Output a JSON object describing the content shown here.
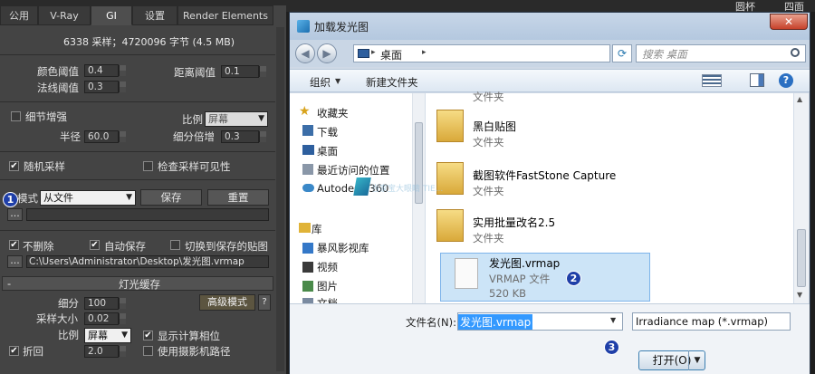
{
  "panel": {
    "tabs": [
      "公用",
      "V-Ray",
      "GI",
      "设置",
      "Render Elements"
    ],
    "active_tab": "GI",
    "stats": "6338 采样；4720096 字节 (4.5 MB)",
    "color_threshold_label": "颜色阈值",
    "color_threshold_value": "0.4",
    "normal_threshold_label": "法线阈值",
    "normal_threshold_value": "0.3",
    "distance_threshold_label": "距离阈值",
    "distance_threshold_value": "0.1",
    "detail_enhance_label": "细节增强",
    "scale_label": "比例",
    "scale_value": "屏幕",
    "radius_label": "半径",
    "radius_value": "60.0",
    "subdiv_mult_label": "细分倍增",
    "subdiv_mult_value": "0.3",
    "random_samples_label": "随机采样",
    "check_visibility_label": "检查采样可见性",
    "mode_label": "模式",
    "mode_value": "从文件",
    "save_button": "保存",
    "reset_button": "重置",
    "browse_button": "...",
    "dont_delete_label": "不删除",
    "auto_save_label": "自动保存",
    "switch_saved_label": "切换到保存的贴图",
    "save_path": "C:\\Users\\Administrator\\Desktop\\发光图.vrmap",
    "light_cache_title": "灯光缓存",
    "subdivs_label": "细分",
    "subdivs_value": "100",
    "sample_size_label": "采样大小",
    "sample_size_value": "0.02",
    "lc_scale_label": "比例",
    "lc_scale_value": "屏幕",
    "advanced_mode_button": "高级模式",
    "help_button": "?",
    "show_calc_label": "显示计算相位",
    "use_camera_label": "使用摄影机路径",
    "retrace_label": "折回",
    "retrace_value": "2.0",
    "minus_sign": "-",
    "top_right_texts": [
      "圆杯",
      "四面"
    ]
  },
  "dialog": {
    "title": "加载发光图",
    "address_root": "桌面",
    "search_placeholder": "搜索 桌面",
    "organize": "组织",
    "new_folder": "新建文件夹",
    "nav_items": [
      "收藏夹",
      "下载",
      "桌面",
      "最近访问的位置",
      "Autodesk 360",
      "库",
      "暴风影视库",
      "视频",
      "图片",
      "文档"
    ],
    "files": [
      {
        "name": "",
        "type": "文件夹"
      },
      {
        "name": "黑白贴图",
        "type": "文件夹"
      },
      {
        "name": "截图软件FastStone Capture",
        "type": "文件夹"
      },
      {
        "name": "实用批量改名2.5",
        "type": "文件夹"
      },
      {
        "name": "发光图.vrmap",
        "type": "VRMAP 文件",
        "size": "520 KB"
      }
    ],
    "filename_label": "文件名(N):",
    "filename_value": "发光图.vrmap",
    "filter_value": "Irradiance map (*.vrmap)",
    "open_button": "打开(O)",
    "close_glyph": "✕"
  },
  "callouts": [
    "1",
    "2",
    "3"
  ],
  "watermark": "当家宝大眼睛 TIE..."
}
